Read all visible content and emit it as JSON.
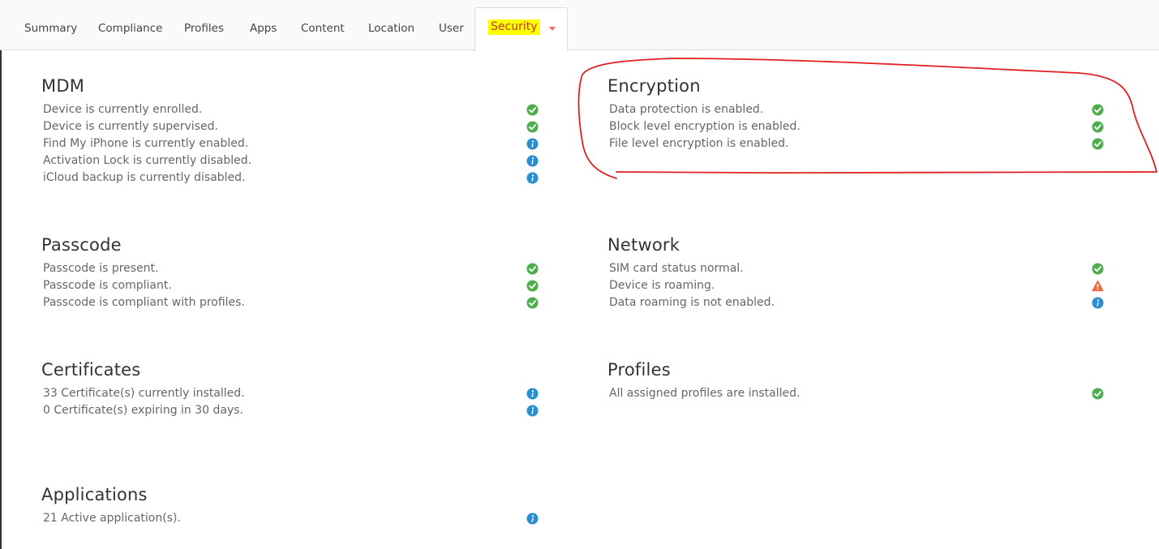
{
  "tabs": [
    {
      "label": "Summary"
    },
    {
      "label": "Compliance"
    },
    {
      "label": "Profiles"
    },
    {
      "label": "Apps"
    },
    {
      "label": "Content"
    },
    {
      "label": "Location"
    },
    {
      "label": "User"
    },
    {
      "label": "Security",
      "active": true
    }
  ],
  "sections": {
    "mdm": {
      "title": "MDM",
      "items": [
        {
          "text": "Device is currently enrolled.",
          "status": "check-icon"
        },
        {
          "text": "Device is currently supervised.",
          "status": "check-icon"
        },
        {
          "text": "Find My iPhone is currently enabled.",
          "status": "info-icon"
        },
        {
          "text": "Activation Lock is currently disabled.",
          "status": "info-icon"
        },
        {
          "text": "iCloud backup is currently disabled.",
          "status": "info-icon"
        }
      ]
    },
    "encryption": {
      "title": "Encryption",
      "items": [
        {
          "text": "Data protection is enabled.",
          "status": "check-icon"
        },
        {
          "text": "Block level encryption is enabled.",
          "status": "check-icon"
        },
        {
          "text": "File level encryption is enabled.",
          "status": "check-icon"
        }
      ]
    },
    "passcode": {
      "title": "Passcode",
      "items": [
        {
          "text": "Passcode is present.",
          "status": "check-icon"
        },
        {
          "text": "Passcode is compliant.",
          "status": "check-icon"
        },
        {
          "text": "Passcode is compliant with profiles.",
          "status": "check-icon"
        }
      ]
    },
    "network": {
      "title": "Network",
      "items": [
        {
          "text": "SIM card status normal.",
          "status": "check-icon"
        },
        {
          "text": "Device is roaming.",
          "status": "warning-icon"
        },
        {
          "text": "Data roaming is not enabled.",
          "status": "info-icon"
        }
      ]
    },
    "certificates": {
      "title": "Certificates",
      "items": [
        {
          "text": "33 Certificate(s) currently installed.",
          "status": "info-icon"
        },
        {
          "text": "0 Certificate(s) expiring in 30 days.",
          "status": "info-icon"
        }
      ]
    },
    "profiles": {
      "title": "Profiles",
      "items": [
        {
          "text": "All assigned profiles are installed.",
          "status": "check-icon"
        }
      ]
    },
    "applications": {
      "title": "Applications",
      "items": [
        {
          "text": "21 Active application(s).",
          "status": "info-icon"
        }
      ]
    }
  },
  "colors": {
    "check": "#4cae4c",
    "info": "#2a8fd0",
    "warning": "#ec6b3c",
    "annotation": "#e02020",
    "highlight": "#ffff00"
  }
}
